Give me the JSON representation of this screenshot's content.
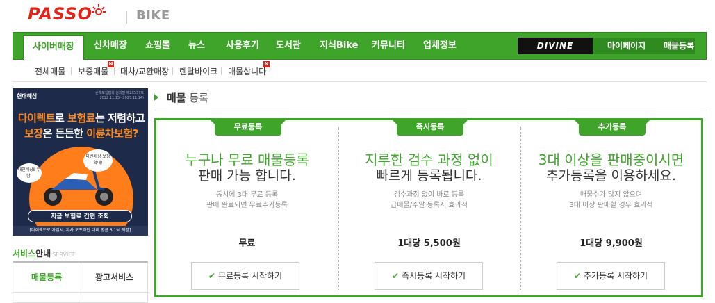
{
  "header": {
    "logo": "PASSO",
    "section": "BIKE"
  },
  "mainnav": {
    "items": [
      "사이버매장",
      "신차매장",
      "쇼핑몰",
      "뉴스",
      "사용후기",
      "도서관",
      "지식Bike",
      "커뮤니티",
      "업체정보"
    ],
    "brand": "DIVINE",
    "mypage": "마이페이지",
    "register": "매물등록"
  },
  "subnav": {
    "items": [
      "전체매물",
      "보증매물",
      "대차/교환매장",
      "렌탈바이크",
      "매물삽니다"
    ],
    "new_badge": "N"
  },
  "banner": {
    "brand": "현대해상",
    "notice": "손해보험협회 심의필 제2X537호 (2022.11.15~2023.11.14)",
    "line1_hl1": "다이렉트",
    "line1_a": "로 ",
    "line1_hl2": "보험료",
    "line1_b": "는 저렴하고",
    "line2_hl1": "보장",
    "line2_a": "은 든든한 ",
    "line2_hl2": "이륜차보험?",
    "bubble_right": "다빈배상 보장 확대!",
    "bubble_left": "대인배상Ⅱ 무한!",
    "cta": "지금 보험료 간편 조회",
    "footer": "[다이렉트로 가입시, 자사 오프라인 대비 평균 6.1% 저렴]"
  },
  "service": {
    "title_a": "서비스",
    "title_b": "안내",
    "title_en": "SERVICE",
    "cells": [
      "매물등록",
      "광고서비스"
    ]
  },
  "page": {
    "title_a": "매물",
    "title_b": " 등록"
  },
  "options": [
    {
      "tab": "무료등록",
      "headline": "누구나 무료 매물등록",
      "subhead": "판매 가능 합니다.",
      "desc1": "동시에 3대 무료 등록",
      "desc2": "판매 완료되면 무료추가등록",
      "price": "무료",
      "button": "무료등록 시작하기"
    },
    {
      "tab": "즉시등록",
      "headline": "지루한 검수 과정 없이",
      "subhead": "빠르게 등록됩니다.",
      "desc1": "검수과정 없이 바로 등록",
      "desc2": "급매물/주말 등록시 효과적",
      "price": "1대당 5,500원",
      "button": "즉시등록 시작하기"
    },
    {
      "tab": "추가등록",
      "headline": "3대 이상을 판매중이시면",
      "subhead": "추가등록을 이용하세요.",
      "desc1": "매물수가 많지 않으며",
      "desc2": "3대 이상 판매할 경우 효과적",
      "price": "1대당 9,900원",
      "button": "추가등록 시작하기"
    }
  ],
  "colors": {
    "accent": "#3ea52a",
    "logo": "#e2231a",
    "banner_bg": "#1e2a4a",
    "banner_orange": "#ff7d1a"
  }
}
